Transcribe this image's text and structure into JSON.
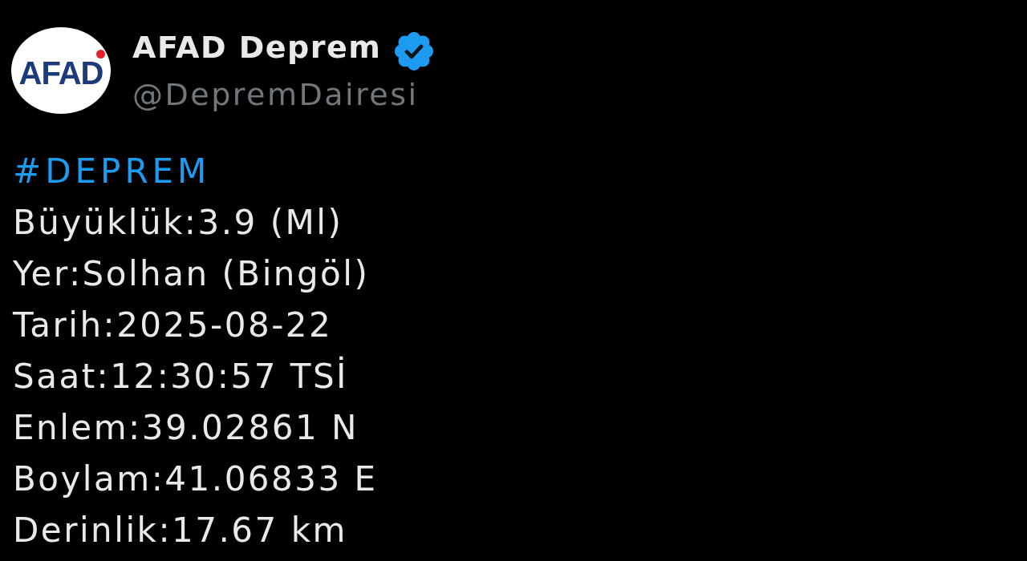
{
  "author": {
    "avatar": {
      "logo_text": "AFAD"
    },
    "display_name": "AFAD Deprem",
    "verified": true,
    "handle": "@DepremDairesi"
  },
  "post": {
    "hashtag": "#DEPREM",
    "lines": [
      "Büyüklük:3.9 (Ml)",
      "Yer:Solhan (Bingöl)",
      "Tarih:2025-08-22",
      "Saat:12:30:57 TSİ",
      "Enlem:39.02861 N",
      "Boylam:41.06833 E",
      "Derinlik:17.67 km"
    ]
  }
}
